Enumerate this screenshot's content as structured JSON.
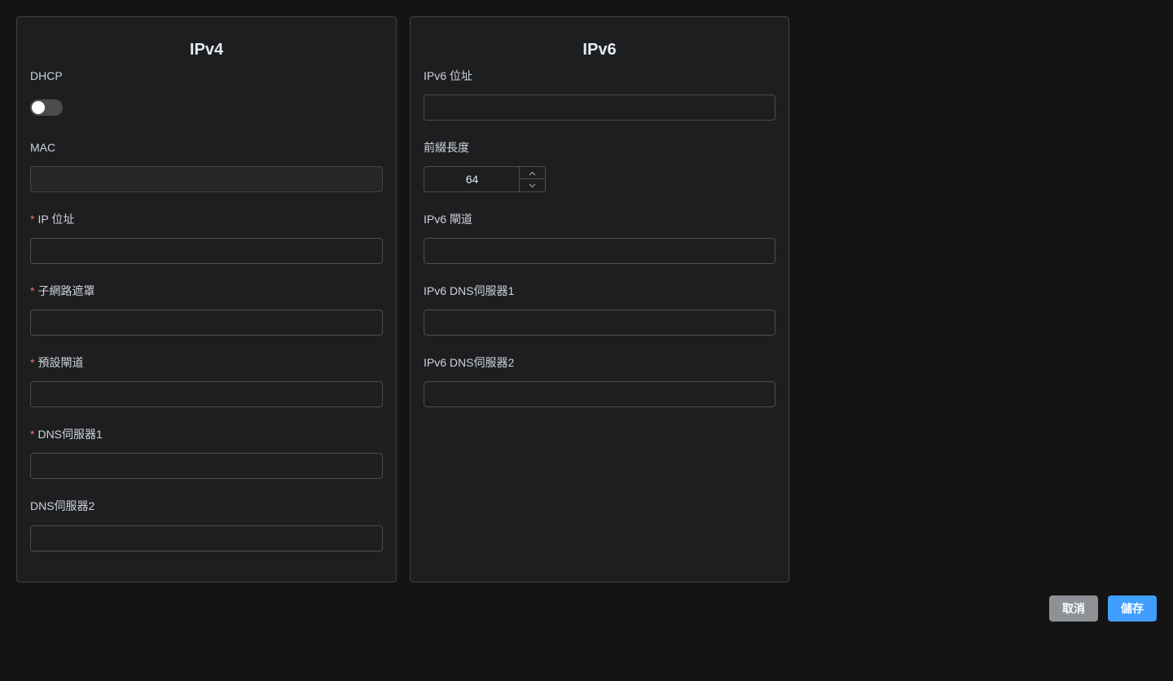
{
  "ipv4": {
    "title": "IPv4",
    "dhcp": {
      "label": "DHCP",
      "enabled": false
    },
    "mac": {
      "label": "MAC",
      "value": ""
    },
    "ip_address": {
      "label": "IP 位址",
      "required_mark": "*",
      "value": ""
    },
    "subnet_mask": {
      "label": "子網路遮罩",
      "required_mark": "*",
      "value": ""
    },
    "default_gateway": {
      "label": "預設閘道",
      "required_mark": "*",
      "value": ""
    },
    "dns1": {
      "label": "DNS伺服器1",
      "required_mark": "*",
      "value": ""
    },
    "dns2": {
      "label": "DNS伺服器2",
      "value": ""
    }
  },
  "ipv6": {
    "title": "IPv6",
    "address": {
      "label": "IPv6 位址",
      "value": ""
    },
    "prefix_length": {
      "label": "前綴長度",
      "value": "64"
    },
    "gateway": {
      "label": "IPv6 閘道",
      "value": ""
    },
    "dns1": {
      "label": "IPv6 DNS伺服器1",
      "value": ""
    },
    "dns2": {
      "label": "IPv6 DNS伺服器2",
      "value": ""
    }
  },
  "actions": {
    "cancel_label": "取消",
    "save_label": "儲存"
  },
  "icons": {
    "stepper_up": "chevron-up-icon",
    "stepper_down": "chevron-down-icon"
  },
  "colors": {
    "accent": "#409eff",
    "required": "#f56c6c",
    "cancel": "#8e9196"
  }
}
